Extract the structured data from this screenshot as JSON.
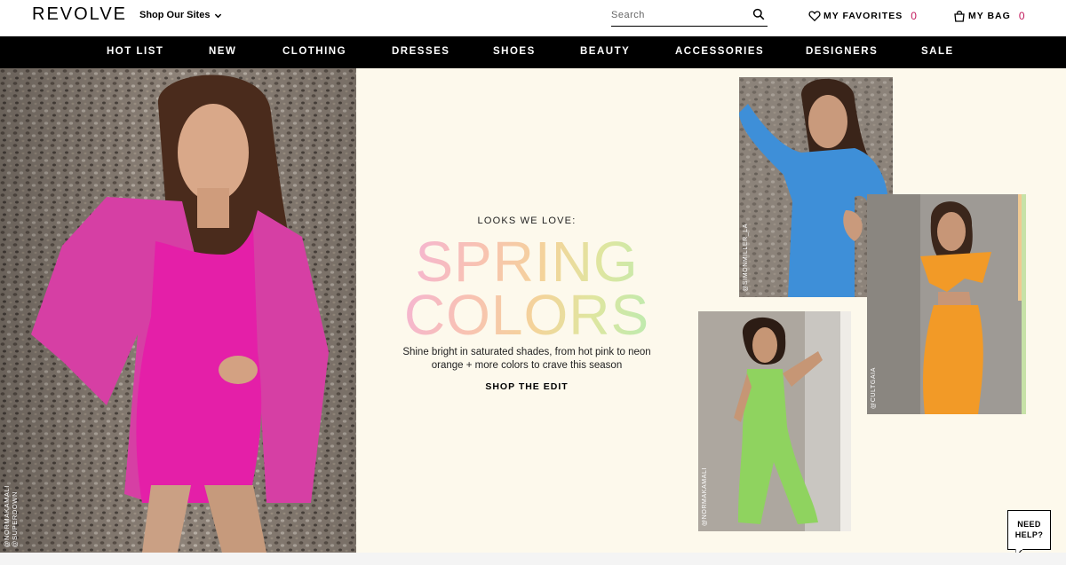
{
  "header": {
    "logo": "REVOLVE",
    "sites_label": "Shop Our Sites",
    "search_placeholder": "Search",
    "favorites_label": "MY FAVORITES",
    "favorites_count": "0",
    "bag_label": "MY BAG",
    "bag_count": "0"
  },
  "nav": {
    "items": [
      "HOT LIST",
      "NEW",
      "CLOTHING",
      "DRESSES",
      "SHOES",
      "BEAUTY",
      "ACCESSORIES",
      "DESIGNERS",
      "SALE"
    ]
  },
  "hero": {
    "eyebrow": "LOOKS WE LOVE:",
    "title_line1": "SPRING",
    "title_line2": "COLORS",
    "description": "Shine bright in saturated shades, from hot pink to neon orange + more colors to crave this season",
    "cta": "SHOP THE EDIT",
    "left_credit_1": "@NORMAKAMALI",
    "left_credit_2": "@SUPERDOWN"
  },
  "gallery": {
    "blue_credit": "@SIMONMILLER_LA",
    "orange_credit": "@CULTGAIA",
    "green_credit": "@NORMAKAMALI"
  },
  "help": {
    "line1": "NEED",
    "line2": "HELP?"
  },
  "colors": {
    "accent_pink": "#c2185b",
    "nav_bg": "#000000",
    "hero_panel_bg": "#fdf9ec"
  },
  "icons": [
    "chevron-down-icon",
    "search-icon",
    "heart-icon",
    "bag-icon"
  ]
}
